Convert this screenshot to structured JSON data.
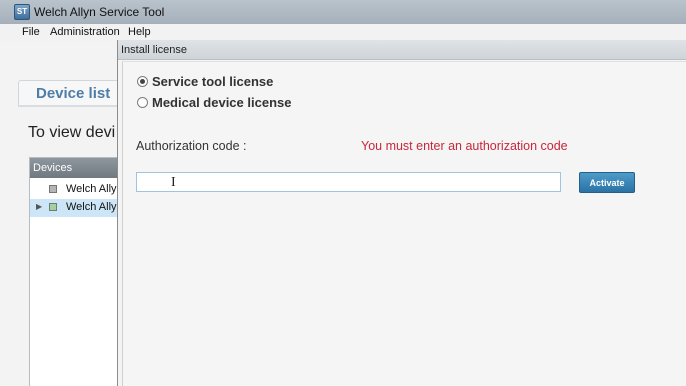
{
  "window": {
    "title": "Welch Allyn Service Tool",
    "icon_text": "ST"
  },
  "menu": {
    "items": [
      {
        "label": "File"
      },
      {
        "label": "Administration"
      },
      {
        "label": "Help"
      }
    ]
  },
  "main": {
    "tab_label": "Device list",
    "instruction": "To view devi",
    "devices_header": "Devices",
    "devices": [
      {
        "label": "Welch Allyn",
        "status_color": "#b5b5b5",
        "expanded": false
      },
      {
        "label": "Welch Allyn",
        "status_color": "#9fd39b",
        "expanded": true,
        "selected": true
      }
    ]
  },
  "dialog": {
    "title": "Install license",
    "license_options": [
      {
        "label": "Service tool license",
        "selected": true
      },
      {
        "label": "Medical device license",
        "selected": false
      }
    ],
    "auth_label": "Authorization code :",
    "error_message": "You must enter an authorization code",
    "auth_value": "",
    "activate_label": "Activate"
  },
  "colors": {
    "accent": "#4d7ea8",
    "error": "#c8263a",
    "button": "#2b72a5",
    "selected_row": "#cde6f7"
  }
}
